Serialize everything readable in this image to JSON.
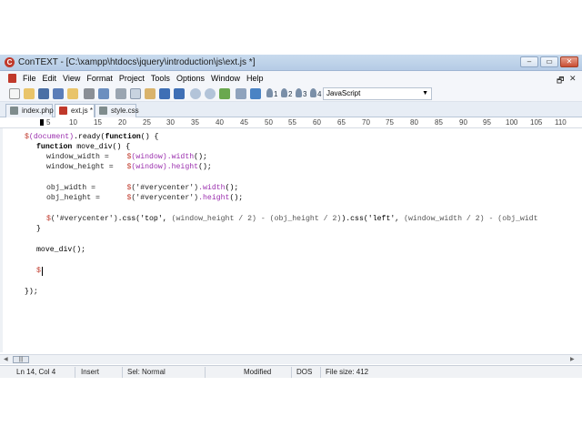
{
  "window": {
    "title": "ConTEXT - [C:\\xampp\\htdocs\\jquery\\introduction\\js\\ext.js *]",
    "app_icon_letter": "C",
    "buttons": [
      "–",
      "▭",
      "✕"
    ]
  },
  "menu": {
    "items": [
      "File",
      "Edit",
      "View",
      "Format",
      "Project",
      "Tools",
      "Options",
      "Window",
      "Help"
    ],
    "mdi_controls": [
      "🗗",
      "✕"
    ]
  },
  "toolbar": {
    "language": "JavaScript",
    "user_commands": [
      "1",
      "2",
      "3",
      "4"
    ]
  },
  "tabs": [
    {
      "label": "index.php",
      "active": false
    },
    {
      "label": "ext.js *",
      "active": true
    },
    {
      "label": "style.css",
      "active": false
    }
  ],
  "ruler": {
    "labels": [
      "5",
      "10",
      "15",
      "20",
      "25",
      "30",
      "35",
      "40",
      "45",
      "50",
      "55",
      "60",
      "65",
      "70",
      "75",
      "80",
      "85",
      "90",
      "95",
      "100",
      "105",
      "110"
    ]
  },
  "code": {
    "l1a": "$",
    "l1b": "(document)",
    "l1c": ".ready(",
    "l1d": "function",
    "l1e": "() {",
    "l2a": "function",
    "l2b": " move_div() {",
    "l3a": "window_width =    ",
    "l3b": "$",
    "l3c": "(window)",
    "l3d": ".width",
    "l3e": "();",
    "l4a": "window_height =   ",
    "l4b": "$",
    "l4c": "(window)",
    "l4d": ".height",
    "l4e": "();",
    "l5a": "obj_width =       ",
    "l5b": "$",
    "l5c": "('#verycenter')",
    "l5d": ".width",
    "l5e": "();",
    "l6a": "obj_height =      ",
    "l6b": "$",
    "l6c": "('#verycenter')",
    "l6d": ".height",
    "l6e": "();",
    "l7a": "$",
    "l7b": "('#verycenter')",
    "l7c": ".css('top', ",
    "l7d": "(window_height / 2) - (obj_height / 2)",
    "l7e": ").css('left', ",
    "l7f": "(window_width / 2) - (obj_widt",
    "l8": "}",
    "l9": "move_div();",
    "l10": "$",
    "l11": "});"
  },
  "status": {
    "position": "Ln 14, Col 4",
    "mode": "Insert",
    "selection": "Sel: Normal",
    "modified": "Modified",
    "format": "DOS",
    "file_size": "File size: 412"
  }
}
